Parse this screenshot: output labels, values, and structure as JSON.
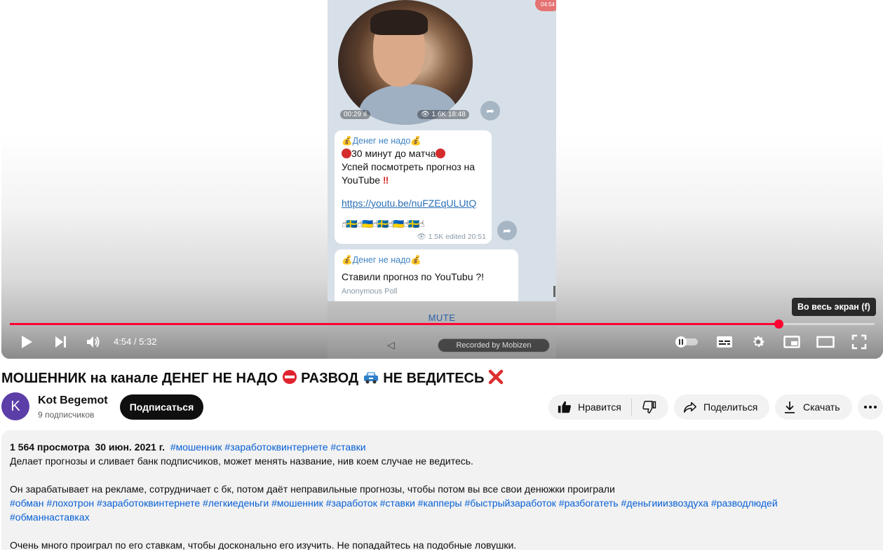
{
  "player": {
    "mute_label": "MUTE",
    "recorded_label": "Recorded by Mobizen",
    "fullscreen_tooltip": "Во весь экран (f)",
    "time_current": "4:54",
    "time_total": "5:32",
    "time_separator": " / ",
    "progress_fraction": 0.889,
    "phone": {
      "timer_badge": "04:54",
      "video_duration": "00:29",
      "video_views": "1.6K",
      "video_time": "18:48",
      "message1": {
        "sender": "Денег не надо",
        "line1": "30 минут до матча",
        "line2": "Успей посмотреть прогноз на",
        "line3": "YouTube",
        "link": "https://youtu.be/nuFZEqULUtQ",
        "emoji_row": "☝🇸🇪☝🇺🇦☝🇸🇪☝🇺🇦☝🇸🇪☝",
        "views": "1.5K",
        "edited": "edited 20:51"
      },
      "message2": {
        "sender": "Денег не надо",
        "text": "Ставили прогноз по YouTubu ?!",
        "type": "Anonymous Poll"
      }
    }
  },
  "video": {
    "title_part1": "МОШЕННИК на канале ДЕНЕГ НЕ НАДО",
    "title_part2": "РАЗВОД",
    "title_part3": "НЕ ВЕДИТЕСЬ"
  },
  "channel": {
    "avatar_letter": "K",
    "name": "Kot Begemot",
    "subscribers": "9 подписчиков",
    "subscribe_label": "Подписаться"
  },
  "actions": {
    "like_label": "Нравится",
    "share_label": "Поделиться",
    "download_label": "Скачать"
  },
  "description": {
    "views": "1 564 просмотра",
    "date": "30 июн. 2021 г.",
    "meta_tags": "#мошенник #заработоквинтернете #ставки",
    "line1": "Делает прогнозы и сливает банк подписчиков, может менять название, нив коем случае не ведитесь.",
    "line2": "Он зарабатывает на рекламе, сотрудничает с бк, потом даёт неправильные прогнозы, чтобы потом вы все свои денюжки проиграли",
    "tags_line1": "#обман #лохотрон #заработоквинтернете #легкиеденьги #мошенник #заработок #ставки #капперы #быстрыйзаработок #разбогатеть #деньгииизвоздуха #разводлюдей",
    "tags_line2": "#обманнаставках",
    "line3": "Очень много проиграл по его ставкам, чтобы досконально его изучить. Не попадайтесь на подобные ловушки."
  },
  "colors": {
    "accent": "#ff0033",
    "link": "#065fd4",
    "pill_bg": "#f2f2f2",
    "avatar": "#5c3ea8"
  }
}
